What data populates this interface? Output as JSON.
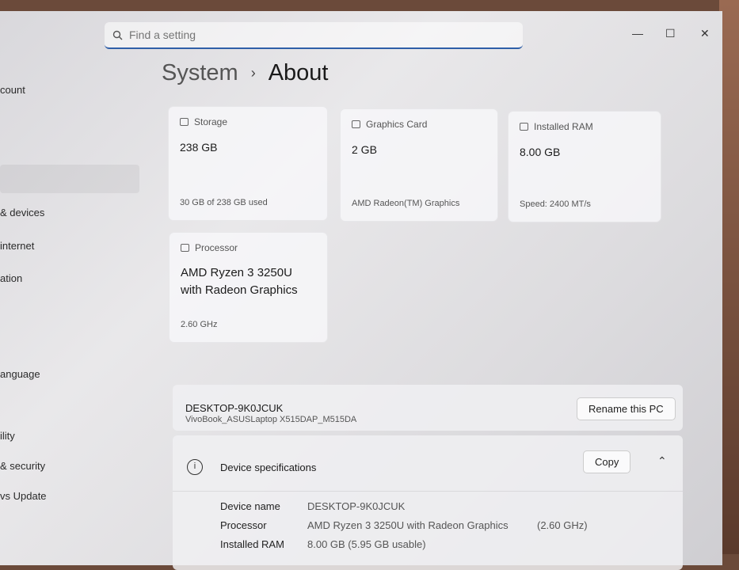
{
  "search": {
    "placeholder": "Find a setting"
  },
  "sidebar": {
    "items": [
      "count",
      "& devices",
      "internet",
      "ation",
      "anguage",
      "ility",
      "& security",
      "vs Update"
    ]
  },
  "window_controls": {
    "minimize": "—",
    "maximize": "☐",
    "close": "✕"
  },
  "breadcrumb": {
    "parent": "System",
    "separator": "›",
    "current": "About"
  },
  "cards": [
    {
      "title": "Storage",
      "value": "238 GB",
      "sub": "30 GB of 238 GB used"
    },
    {
      "title": "Graphics Card",
      "value": "2 GB",
      "sub": "AMD Radeon(TM) Graphics"
    },
    {
      "title": "Installed RAM",
      "value": "8.00 GB",
      "sub": "Speed: 2400 MT/s"
    },
    {
      "title": "Processor",
      "value": "AMD Ryzen 3 3250U with Radeon Graphics",
      "sub": "2.60 GHz"
    }
  ],
  "pc": {
    "name": "DESKTOP-9K0JCUK",
    "model": "VivoBook_ASUSLaptop X515DAP_M515DA",
    "rename_label": "Rename this PC"
  },
  "specs": {
    "title": "Device specifications",
    "copy_label": "Copy",
    "collapse": "⌃",
    "info": "i",
    "rows": [
      {
        "key": "Device name",
        "value": "DESKTOP-9K0JCUK",
        "extra": ""
      },
      {
        "key": "Processor",
        "value": "AMD Ryzen 3 3250U with Radeon Graphics",
        "extra": "(2.60 GHz)"
      },
      {
        "key": "Installed RAM",
        "value": "8.00 GB (5.95 GB usable)",
        "extra": ""
      }
    ]
  }
}
